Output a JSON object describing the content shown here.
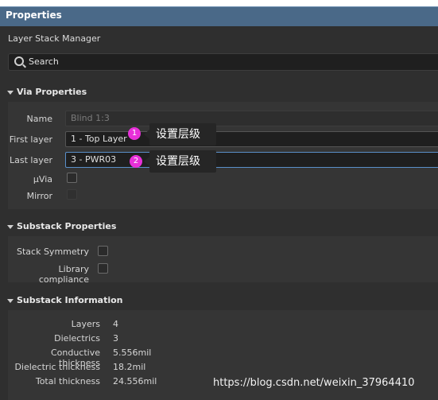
{
  "panel": {
    "title": "Properties",
    "subtitle": "Layer Stack Manager"
  },
  "search": {
    "placeholder": "Search"
  },
  "via_properties": {
    "header": "Via Properties",
    "name_label": "Name",
    "name_value": "Blind 1:3",
    "first_layer_label": "First layer",
    "first_layer_value": "1 - Top Layer",
    "last_layer_label": "Last layer",
    "last_layer_value": "3 - PWR03",
    "uvia_label": "µVia",
    "mirror_label": "Mirror"
  },
  "annotations": [
    {
      "badge": "1",
      "text": "设置层级"
    },
    {
      "badge": "2",
      "text": "设置层级"
    }
  ],
  "substack_properties": {
    "header": "Substack Properties",
    "symmetry_label": "Stack Symmetry",
    "compliance_label": "Library compliance"
  },
  "substack_information": {
    "header": "Substack Information",
    "rows": [
      {
        "label": "Layers",
        "value": "4"
      },
      {
        "label": "Dielectrics",
        "value": "3"
      },
      {
        "label": "Conductive thickness",
        "value": "5.556mil"
      },
      {
        "label": "Dielectric thickness",
        "value": "18.2mil"
      },
      {
        "label": "Total thickness",
        "value": "24.556mil"
      }
    ]
  },
  "watermark": "https://blog.csdn.net/weixin_37964410",
  "colors": {
    "title_bar": "#4a6988",
    "badge": "#e830d9",
    "focus_border": "#5a8fc9"
  }
}
